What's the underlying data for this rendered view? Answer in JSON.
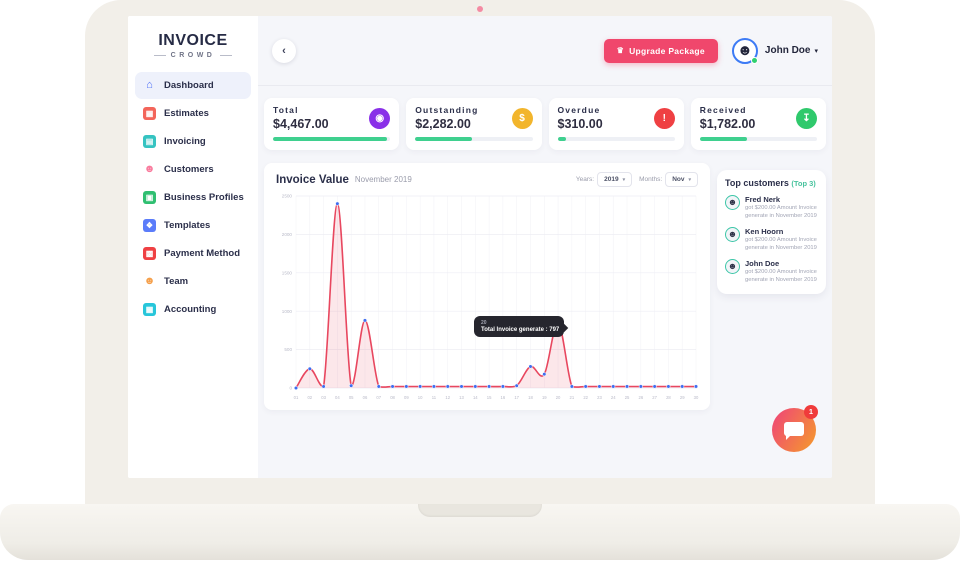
{
  "logo": {
    "name": "INVOICE",
    "tagline": "CROWD"
  },
  "topbar": {
    "back_icon": "‹",
    "upgrade_icon": "♛",
    "upgrade_label": "Upgrade Package",
    "user_name": "John Doe",
    "avatar_glyph": "☻",
    "caret": "▾"
  },
  "sidebar": {
    "items": [
      {
        "label": "Dashboard",
        "icon": "home",
        "glyph": "⌂",
        "icon_bg": "transparent",
        "icon_color": "#4a6cf7",
        "active": true
      },
      {
        "label": "Estimates",
        "icon": "estimates-calculator",
        "glyph": "▦",
        "icon_bg": "#f3655a",
        "icon_color": "#ffffff",
        "active": false
      },
      {
        "label": "Invoicing",
        "icon": "invoice-document",
        "glyph": "▤",
        "icon_bg": "#35c3c1",
        "icon_color": "#ffffff",
        "active": false
      },
      {
        "label": "Customers",
        "icon": "customers-person",
        "glyph": "☻",
        "icon_bg": "transparent",
        "icon_color": "#f97b9d",
        "active": false
      },
      {
        "label": "Business Profiles",
        "icon": "business-briefcase",
        "glyph": "▣",
        "icon_bg": "#2fbf71",
        "icon_color": "#ffffff",
        "active": false
      },
      {
        "label": "Templates",
        "icon": "templates",
        "glyph": "❖",
        "icon_bg": "#5b7cfa",
        "icon_color": "#ffffff",
        "active": false
      },
      {
        "label": "Payment Method",
        "icon": "payment-card",
        "glyph": "▩",
        "icon_bg": "#ef4043",
        "icon_color": "#ffffff",
        "active": false
      },
      {
        "label": "Team",
        "icon": "team-people",
        "glyph": "☻",
        "icon_bg": "transparent",
        "icon_color": "#f59f4a",
        "active": false
      },
      {
        "label": "Accounting",
        "icon": "accounting-calculator",
        "glyph": "▦",
        "icon_bg": "#27c6da",
        "icon_color": "#ffffff",
        "active": false
      }
    ]
  },
  "stats": [
    {
      "label": "Total",
      "amount": "$4,467.00",
      "icon": "total-ring-icon",
      "glyph": "◉",
      "color": "#8930e8",
      "progress": 97
    },
    {
      "label": "Outstanding",
      "amount": "$2,282.00",
      "icon": "outstanding-coin-icon",
      "glyph": "$",
      "color": "#f2b52c",
      "progress": 48
    },
    {
      "label": "Overdue",
      "amount": "$310.00",
      "icon": "overdue-alarm-icon",
      "glyph": "!",
      "color": "#ef4043",
      "progress": 7
    },
    {
      "label": "Received",
      "amount": "$1,782.00",
      "icon": "received-arrow-icon",
      "glyph": "↧",
      "color": "#2fc96c",
      "progress": 40
    }
  ],
  "progress_color": "#3fd08f",
  "chart_card": {
    "title": "Invoice Value",
    "subtitle": "November 2019",
    "years_label": "Years:",
    "year_value": "2019",
    "months_label": "Months:",
    "month_value": "Nov",
    "caret": "▾"
  },
  "tooltip": {
    "line1": "20",
    "line2": "Total Invoice generate : 797"
  },
  "chart_data": {
    "type": "area",
    "title": "Invoice Value",
    "subtitle": "November 2019",
    "x": [
      "01",
      "02",
      "03",
      "04",
      "05",
      "06",
      "07",
      "08",
      "09",
      "10",
      "11",
      "12",
      "13",
      "14",
      "15",
      "16",
      "17",
      "18",
      "19",
      "20",
      "21",
      "22",
      "23",
      "24",
      "25",
      "26",
      "27",
      "28",
      "29",
      "30"
    ],
    "values": [
      0,
      250,
      20,
      2400,
      30,
      880,
      20,
      20,
      20,
      20,
      20,
      20,
      20,
      20,
      20,
      20,
      30,
      280,
      180,
      850,
      20,
      20,
      20,
      20,
      20,
      20,
      20,
      20,
      20,
      20
    ],
    "ylim": [
      0,
      2500
    ],
    "yticks": [
      0,
      500,
      1000,
      1500,
      2000,
      2500
    ],
    "grid": true,
    "legend": false,
    "line_color": "#e8475f",
    "fill_color": "rgba(232,71,95,0.13)",
    "dot_color": "#3e6df0",
    "grid_color": "#ededf4",
    "tick_color": "#b9bac8"
  },
  "top_customers": {
    "title": "Top customers",
    "badge": "(Top 3)",
    "avatar_glyph": "☻",
    "customers": [
      {
        "name": "Fred Nerk",
        "desc": "got $200.00 Amount Invoice generate in November 2019"
      },
      {
        "name": "Ken Hoorn",
        "desc": "got $200.00 Amount Invoice generate in November 2019"
      },
      {
        "name": "John Doe",
        "desc": "got $200.00 Amount Invoice generate in November 2019"
      }
    ]
  },
  "chat": {
    "badge": "1"
  }
}
